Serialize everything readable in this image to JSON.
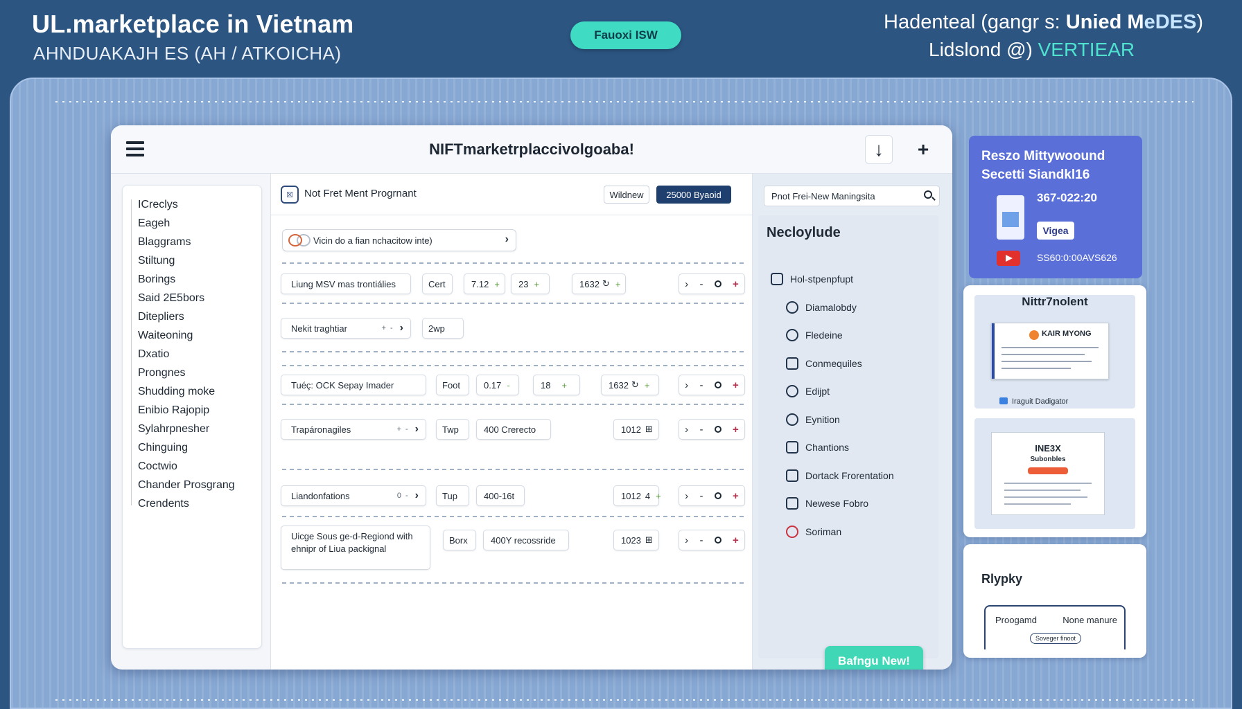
{
  "header": {
    "title": "UL.marketplace in Vietnam",
    "subtitle": "AHNDUAKAJH ES (AH / ATKOICHA)",
    "pill": "Fauoxi ISW",
    "right_line1_prefix": "Hadenteal (gangr s: ",
    "right_line1_bold": "Unied M",
    "right_line1_light": "eDES",
    "right_line1_suffix": ")",
    "right_line2_prefix": "Lidslond @) ",
    "right_line2_accent": "VERTIEAR"
  },
  "window": {
    "title": "NIFTmarketrplaccivolgoaba!",
    "download_glyph": "↓",
    "add_glyph": "+"
  },
  "sidebar": {
    "items": [
      "ICreclys",
      "Eageh",
      "Blaggrams",
      "Stiltung",
      "Borings",
      "Said 2E5bors",
      "Ditepliers",
      "Waiteoning",
      "Dxatio",
      "Prongnes",
      "Shudding moke",
      "Enibio Rajopip",
      "Sylahrpnesher",
      "Chinguing",
      "Coctwio",
      "Chander Prosgrang",
      "Crendents"
    ]
  },
  "center": {
    "program_icon": "☒",
    "program_label": "Not Fret Ment Progrnant",
    "window_btn": "Wildnew",
    "dark_btn": "25000 Byaoid",
    "search_text": "Vicin do a fian nchacitow inte)",
    "rows": [
      {
        "name": "Liung MSV mas trontiálies",
        "type": "Cert",
        "v1": "7.12",
        "v2": "23",
        "v3": "1632"
      },
      {
        "name": "Nekit traghtiar",
        "type": "2wp",
        "v1": "",
        "v2": "",
        "v3": ""
      },
      {
        "name": "Tuéç: OCK Sepay Imader",
        "type": "Foot",
        "v1": "0.17",
        "v2": "18",
        "v3": "1632"
      },
      {
        "name": "Trapáronagiles",
        "type": "Twp",
        "v1": "400 Crerecto",
        "v2": "",
        "v3": "1012"
      },
      {
        "name": "Liandonfations",
        "type": "Tup",
        "v1": "400-16t",
        "v2": "",
        "v3": "1012"
      },
      {
        "name": "Uicge Sous ge-d-Regiond with ehnipr of Liua packignal",
        "type": "Borx",
        "v1": "400Y recossride",
        "v2": "",
        "v3": "1023"
      }
    ],
    "ctrl_left": "›",
    "ctrl_dash": "-",
    "ctrl_plus": "+",
    "cell_plus": "+",
    "cell_chevron": "›",
    "mid_value": "0",
    "mid_value_a": "4",
    "sync_glyph": "↻",
    "grid_glyph": "⊞"
  },
  "right_panel": {
    "search_text": "Pnot Frei-New Maningsita",
    "heading": "Necloylude",
    "items": [
      "Hol-stpenpfupt",
      "Diamalobdy",
      "Fledeine",
      "Conmequiles",
      "Edijpt",
      "Eynition",
      "Chantions",
      "Dortack Frorentation",
      "Newese Fobro",
      "Soriman"
    ],
    "cta": "Bafngu New!"
  },
  "promo_card": {
    "line1": "Reszo Mittywoound",
    "line2": "Secetti Siandkl16",
    "number": "367-022:20",
    "tag": "Vigea",
    "code": "SS60:0:00AVS626"
  },
  "nft_card": {
    "title": "Nittr7nolent",
    "doc_title": "KAIR MYONG",
    "caption": "Iraguit Dadigator",
    "doc2_title": "INE3X",
    "doc2_sub": "Subonbles"
  },
  "replay_card": {
    "title": "Rlypky",
    "left": "Proogamd",
    "right": "None manure",
    "mini": "Soveger finoot"
  }
}
